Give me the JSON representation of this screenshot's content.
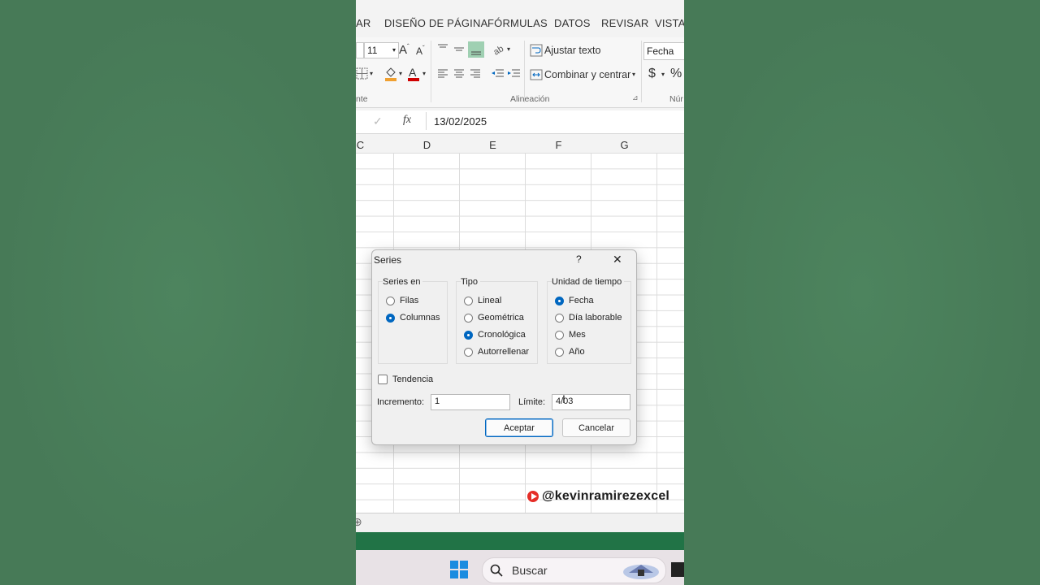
{
  "ribbon_tabs": [
    "AR",
    "DISEÑO DE PÁGINA",
    "FÓRMULAS",
    "DATOS",
    "REVISAR",
    "VISTA"
  ],
  "ribbon": {
    "font_size": "11",
    "wrap_text": "Ajustar texto",
    "merge_center": "Combinar y centrar",
    "number_format": "Fecha",
    "currency": "$",
    "percent": "%",
    "group_font": "nte",
    "group_alignment": "Alineación",
    "group_number": "Núr"
  },
  "formula_bar": {
    "fx": "fx",
    "value": "13/02/2025"
  },
  "columns": [
    "C",
    "D",
    "E",
    "F",
    "G"
  ],
  "dialog": {
    "title": "Series",
    "help": "?",
    "close": "✕",
    "series_in": {
      "legend": "Series en",
      "options": [
        "Filas",
        "Columnas"
      ],
      "selected": "Columnas"
    },
    "type": {
      "legend": "Tipo",
      "options": [
        "Lineal",
        "Geométrica",
        "Cronológica",
        "Autorrellenar"
      ],
      "selected": "Cronológica"
    },
    "date_unit": {
      "legend": "Unidad de tiempo",
      "options": [
        "Fecha",
        "Día laborable",
        "Mes",
        "Año"
      ],
      "selected": "Fecha"
    },
    "trend_label": "Tendencia",
    "increment_label": "Incremento:",
    "increment_value": "1",
    "limit_label": "Límite:",
    "limit_value": "4/03",
    "ok": "Aceptar",
    "cancel": "Cancelar"
  },
  "watermark": "@kevinramirezexcel",
  "taskbar": {
    "search": "Buscar"
  },
  "colors": {
    "background": "#4a7f5a",
    "excel_green": "#217346",
    "accent_blue": "#0067c0"
  }
}
